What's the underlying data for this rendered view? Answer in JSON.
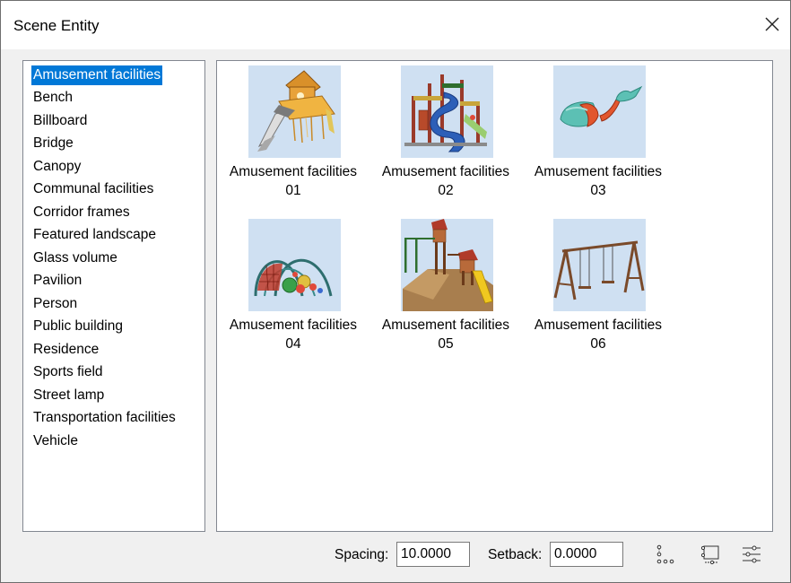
{
  "window": {
    "title": "Scene Entity",
    "close_icon": "close-icon"
  },
  "categories": {
    "selected_index": 0,
    "items": [
      "Amusement facilities",
      "Bench",
      "Billboard",
      "Bridge",
      "Canopy",
      "Communal facilities",
      "Corridor frames",
      "Featured landscape",
      "Glass volume",
      "Pavilion",
      "Person",
      "Public building",
      "Residence",
      "Sports field",
      "Street lamp",
      "Transportation facilities",
      "Vehicle"
    ]
  },
  "thumbnails": [
    {
      "line1": "Amusement facilities",
      "line2": "01",
      "image": "playhouse-with-slide"
    },
    {
      "line1": "Amusement facilities",
      "line2": "02",
      "image": "play-tower-with-spiral-slide"
    },
    {
      "line1": "Amusement facilities",
      "line2": "03",
      "image": "whale-sculpture"
    },
    {
      "line1": "Amusement facilities",
      "line2": "04",
      "image": "arch-climbing-frame"
    },
    {
      "line1": "Amusement facilities",
      "line2": "05",
      "image": "playground-with-slide-on-mound"
    },
    {
      "line1": "Amusement facilities",
      "line2": "06",
      "image": "swing-set"
    }
  ],
  "footer": {
    "spacing_label": "Spacing:",
    "spacing_value": "10.0000",
    "setback_label": "Setback:",
    "setback_value": "0.0000",
    "tool_icons": [
      "array-along-line-icon",
      "place-on-rectangle-icon",
      "settings-sliders-icon"
    ]
  },
  "colors": {
    "selection": "#0078d7",
    "thumb_background": "#cfe0f2"
  }
}
